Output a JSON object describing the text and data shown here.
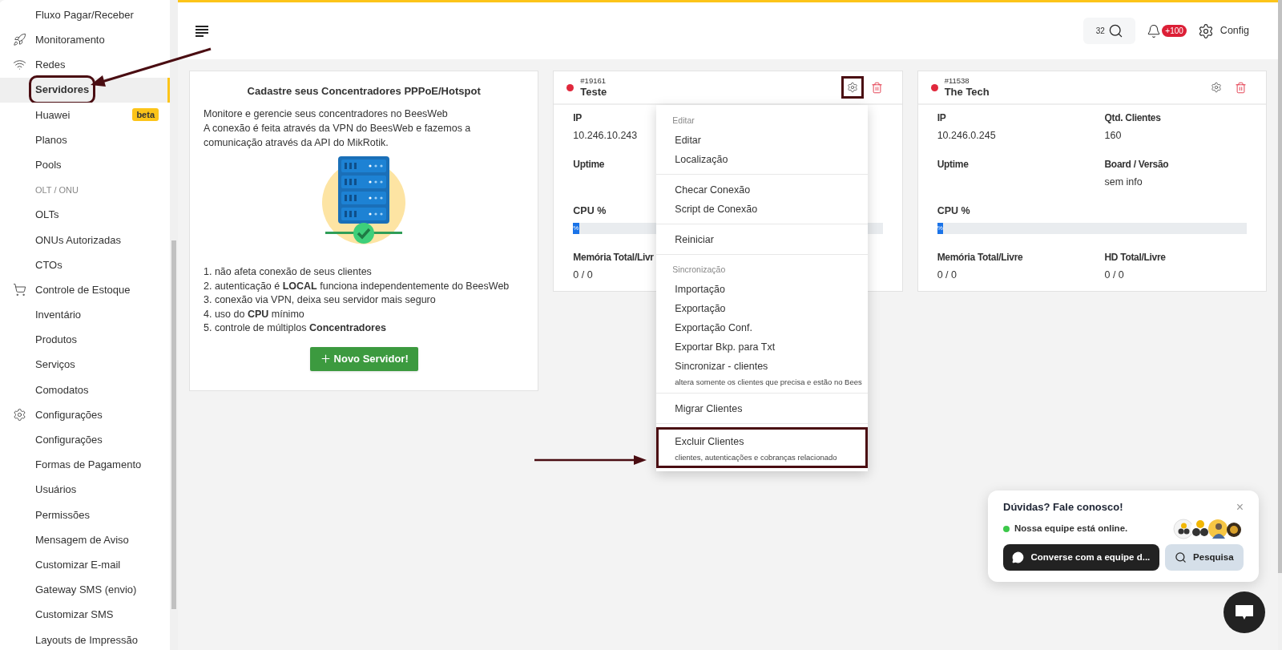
{
  "sidebar": {
    "items": [
      {
        "label": "Fluxo Pagar/Receber",
        "kind": "item",
        "selected": false
      },
      {
        "label": "Monitoramento",
        "kind": "group",
        "selected": false
      },
      {
        "label": "Redes",
        "kind": "group",
        "selected": false
      },
      {
        "label": "Servidores",
        "kind": "item",
        "selected": true,
        "annotated": true
      },
      {
        "label": "Huawei",
        "kind": "item",
        "selected": false,
        "badge": "beta"
      },
      {
        "label": "Planos",
        "kind": "item",
        "selected": false
      },
      {
        "label": "Pools",
        "kind": "item",
        "selected": false
      },
      {
        "label": "OLT / ONU",
        "kind": "heading",
        "selected": false
      },
      {
        "label": "OLTs",
        "kind": "item",
        "selected": false
      },
      {
        "label": "ONUs Autorizadas",
        "kind": "item",
        "selected": false
      },
      {
        "label": "CTOs",
        "kind": "item",
        "selected": false
      },
      {
        "label": "Controle de Estoque",
        "kind": "group",
        "selected": false
      },
      {
        "label": "Inventário",
        "kind": "item",
        "selected": false
      },
      {
        "label": "Produtos",
        "kind": "item",
        "selected": false
      },
      {
        "label": "Serviços",
        "kind": "item",
        "selected": false
      },
      {
        "label": "Comodatos",
        "kind": "item",
        "selected": false
      },
      {
        "label": "Configurações",
        "kind": "group",
        "selected": false
      },
      {
        "label": "Configurações",
        "kind": "item",
        "selected": false
      },
      {
        "label": "Formas de Pagamento",
        "kind": "item",
        "selected": false
      },
      {
        "label": "Usuários",
        "kind": "item",
        "selected": false
      },
      {
        "label": "Permissões",
        "kind": "item",
        "selected": false
      },
      {
        "label": "Mensagem de Aviso",
        "kind": "item",
        "selected": false
      },
      {
        "label": "Customizar E-mail",
        "kind": "item",
        "selected": false
      },
      {
        "label": "Gateway SMS (envio)",
        "kind": "item",
        "selected": false
      },
      {
        "label": "Customizar SMS",
        "kind": "item",
        "selected": false
      },
      {
        "label": "Layouts de Impressão",
        "kind": "item",
        "selected": false
      }
    ]
  },
  "header": {
    "search_count": "32",
    "notifications": "+100",
    "config": "Config"
  },
  "intro": {
    "title": "Cadastre seus Concentradores PPPoE/Hotspot",
    "paragraphs": [
      "Monitore e gerencie seus concentradores no BeesWeb",
      "A conexão é feita através da VPN do BeesWeb e fazemos a comunicação através da API do MikRotik."
    ],
    "points": [
      "1. não afeta conexão de seus clientes",
      "2. autenticação é **LOCAL** funciona independentemente do BeesWeb",
      "3. conexão via VPN, deixa seu servidor mais seguro",
      "4. uso do **CPU** mínimo",
      "5. controle de múltiplos **Concentradores**"
    ],
    "button": "Novo Servidor!"
  },
  "servers": [
    {
      "id": "#19161",
      "name": "Teste",
      "online": false,
      "gear_annotated": true,
      "rows": [
        {
          "kind": "fields",
          "cells": [
            {
              "label": "IP",
              "value": "10.246.10.243"
            }
          ]
        },
        {
          "kind": "fields",
          "cells": [
            {
              "label": "Uptime"
            }
          ]
        },
        {
          "kind": "bar",
          "label": "CPU %",
          "level": 0.02,
          "reading": "%"
        },
        {
          "kind": "fields",
          "cells": [
            {
              "label": "Memória Total/Livr",
              "value": "0 / 0"
            }
          ]
        }
      ],
      "menu": {
        "sections": [
          {
            "items": [
              {
                "kind": "heading",
                "label": "Editar"
              },
              {
                "kind": "item",
                "label": "Editar"
              },
              {
                "kind": "item",
                "label": "Localização"
              }
            ]
          },
          {
            "items": [
              {
                "kind": "item",
                "label": "Checar Conexão"
              },
              {
                "kind": "item",
                "label": "Script de Conexão"
              }
            ]
          },
          {
            "items": [
              {
                "kind": "item",
                "label": "Reiniciar"
              }
            ]
          },
          {
            "items": [
              {
                "kind": "heading",
                "label": "Sincronização"
              },
              {
                "kind": "item",
                "label": "Importação"
              },
              {
                "kind": "item",
                "label": "Exportação"
              },
              {
                "kind": "item",
                "label": "Exportação Conf."
              },
              {
                "kind": "item",
                "label": "Exportar Bkp. para Txt"
              },
              {
                "kind": "item",
                "label": "Sincronizar - clientes",
                "note": "altera somente os clientes que precisa e estão no Bees"
              }
            ]
          },
          {
            "items": [
              {
                "kind": "item",
                "label": "Migrar Clientes"
              }
            ]
          },
          {
            "items": [
              {
                "kind": "item",
                "label": "Excluir Clientes",
                "note": "clientes, autenticações e cobranças relacionado",
                "annotated": true
              }
            ]
          }
        ]
      }
    },
    {
      "id": "#11538",
      "name": "The Tech",
      "online": false,
      "gear_annotated": false,
      "rows": [
        {
          "kind": "fields",
          "cells": [
            {
              "label": "IP",
              "value": "10.246.0.245"
            },
            {
              "label": "Qtd. Clientes",
              "value": "160"
            }
          ]
        },
        {
          "kind": "fields",
          "cells": [
            {
              "label": "Uptime"
            },
            {
              "label": "Board / Versão",
              "value": "sem info"
            }
          ]
        },
        {
          "kind": "bar",
          "label": "CPU %",
          "level": 0.02,
          "reading": "%"
        },
        {
          "kind": "fields",
          "cells": [
            {
              "label": "Memória Total/Livre",
              "value": "0 / 0"
            },
            {
              "label": "HD Total/Livre",
              "value": "0 / 0"
            }
          ]
        }
      ]
    }
  ],
  "chat": {
    "title": "Dúvidas? Fale conosco!",
    "close": "×",
    "status": "Nossa equipe está online.",
    "online": true,
    "chat_button": "Converse com a equipe d...",
    "search_button": "Pesquisa"
  }
}
